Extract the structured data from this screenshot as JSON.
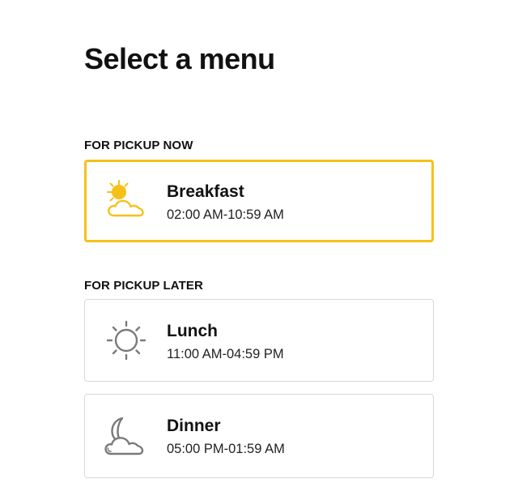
{
  "page": {
    "title": "Select a menu"
  },
  "sections": {
    "now": {
      "label": "FOR PICKUP NOW"
    },
    "later": {
      "label": "FOR PICKUP LATER"
    }
  },
  "menus": {
    "breakfast": {
      "name": "Breakfast",
      "hours": "02:00 AM-10:59 AM",
      "icon": "sun-cloud-icon",
      "selected": true
    },
    "lunch": {
      "name": "Lunch",
      "hours": "11:00 AM-04:59 PM",
      "icon": "sun-icon",
      "selected": false
    },
    "dinner": {
      "name": "Dinner",
      "hours": "05:00 PM-01:59 AM",
      "icon": "moon-cloud-icon",
      "selected": false
    }
  },
  "colors": {
    "accent": "#f5c118",
    "icon_inactive": "#7a7a7a",
    "border": "#d8d8d8"
  }
}
